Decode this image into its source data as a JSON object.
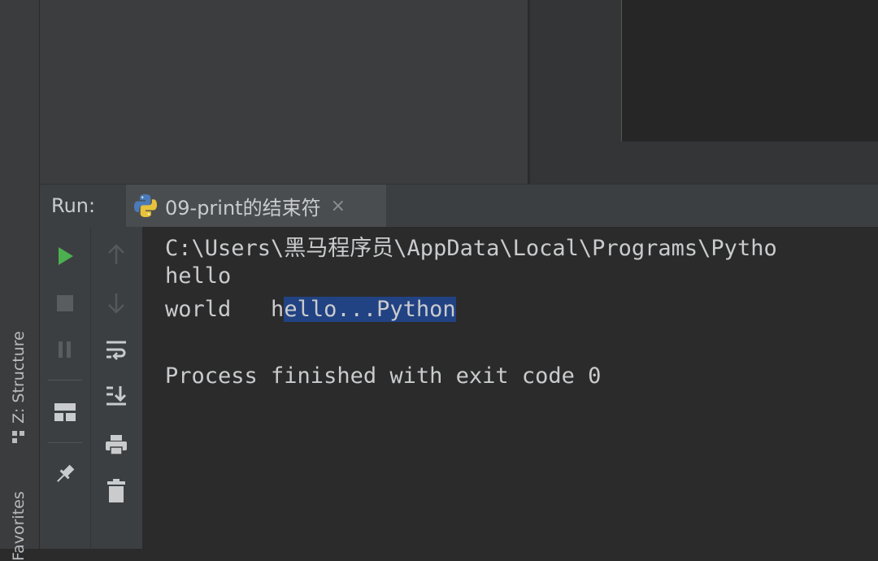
{
  "left_sidebar": {
    "structure_tab": "Z: Structure",
    "favorites_tab": "Favorites"
  },
  "run_panel": {
    "label": "Run:",
    "tab_title": "09-print的结束符",
    "close_symbol": "×"
  },
  "console": {
    "lines": [
      "C:\\Users\\黑马程序员\\AppData\\Local\\Programs\\Pytho",
      "hello",
      "",
      "",
      "Process finished with exit code 0"
    ],
    "line3_unselected": "world   h",
    "line3_selected": "ello...Python"
  },
  "toolbar_icons": {
    "left": [
      "run-icon",
      "stop-icon",
      "pause-icon",
      "layout-icon",
      "pin-icon"
    ],
    "right": [
      "up-arrow-icon",
      "down-arrow-icon",
      "soft-wrap-icon",
      "scroll-to-end-icon",
      "print-icon",
      "trash-icon"
    ]
  },
  "colors": {
    "run_green": "#4caf50",
    "selection": "#214283",
    "console_bg": "#2b2b2b",
    "console_text": "#c9cbcd"
  }
}
